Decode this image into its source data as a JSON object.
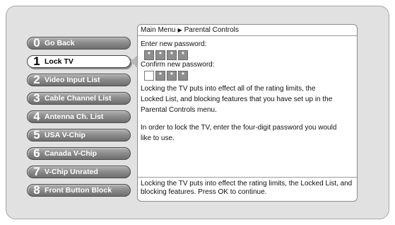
{
  "menu": {
    "items": [
      {
        "number": "0",
        "label": "Go Back"
      },
      {
        "number": "1",
        "label": "Lock TV",
        "selected": true
      },
      {
        "number": "2",
        "label": "Video Input List"
      },
      {
        "number": "3",
        "label": "Cable Channel List"
      },
      {
        "number": "4",
        "label": "Antenna Ch. List"
      },
      {
        "number": "5",
        "label": "USA V-Chip"
      },
      {
        "number": "6",
        "label": "Canada V-Chip"
      },
      {
        "number": "7",
        "label": "V-Chip Unrated"
      },
      {
        "number": "8",
        "label": "Front Button Block"
      }
    ]
  },
  "panel": {
    "breadcrumb": {
      "root": "Main Menu",
      "current": "Parental Controls"
    },
    "new_password_label": "Enter new password:",
    "confirm_password_label": "Confirm new password:",
    "new_password_mask": [
      "*",
      "*",
      "*",
      "*"
    ],
    "confirm_password_mask": [
      "",
      "*",
      "*",
      "*"
    ],
    "description_1": "Locking the TV puts into effect all of the rating limits, the Locked List, and blocking features that you have set up in the Parental Controls menu.",
    "description_2": "In order to lock the TV, enter the four-digit password you would like to use.",
    "footer_text": "Locking the TV puts into effect the rating limits, the Locked List, and blocking features. Press OK to continue."
  },
  "colors": {
    "screen_bg": "#e1e1e1",
    "button_gray": "#8d8d8d",
    "button_selected": "#ffffff",
    "password_box": "#8e8e8e"
  }
}
